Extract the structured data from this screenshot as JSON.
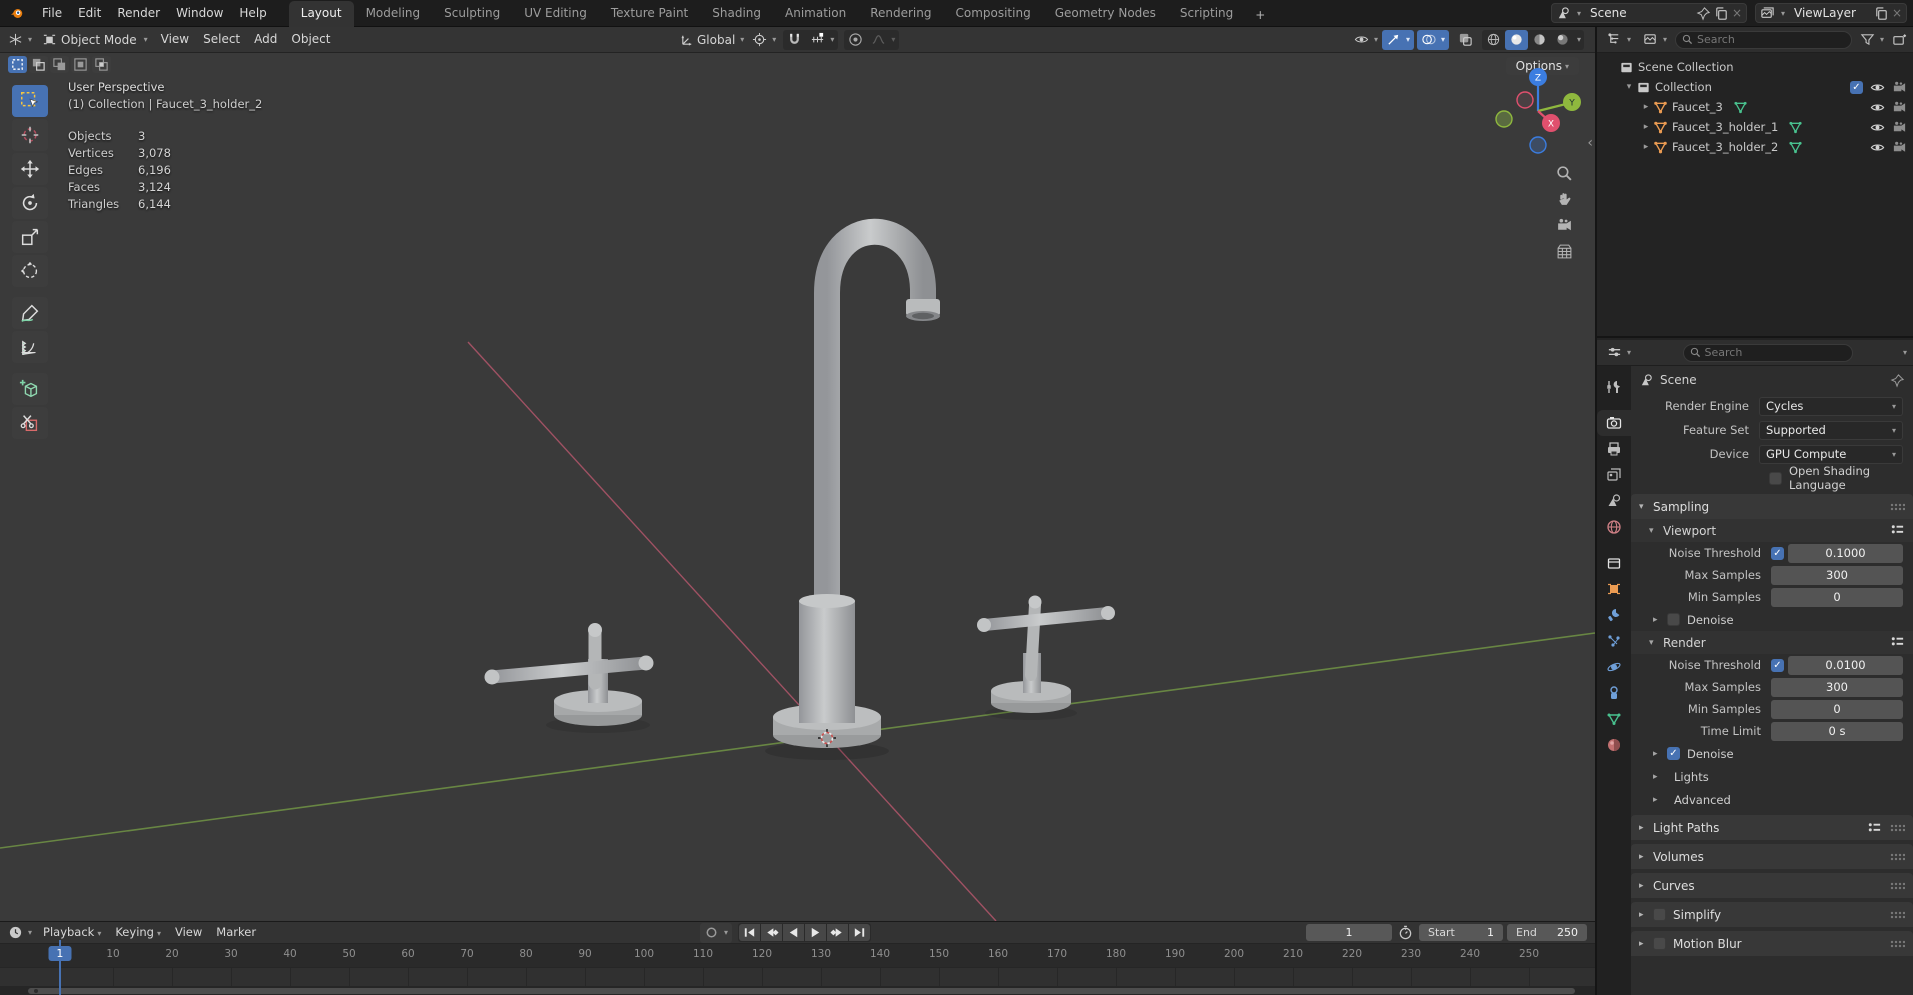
{
  "colors": {
    "accent": "#4772b3",
    "object_orange": "#eb9b52",
    "data_green": "#49c28f",
    "axis_x_red": "#b2566b",
    "axis_y_green": "#6e8f45",
    "gizmo_z": "#3b7de0",
    "gizmo_y": "#8fb83e",
    "gizmo_x": "#e0506e"
  },
  "topbar": {
    "menus": [
      "File",
      "Edit",
      "Render",
      "Window",
      "Help"
    ],
    "workspace_tabs": [
      "Layout",
      "Modeling",
      "Sculpting",
      "UV Editing",
      "Texture Paint",
      "Shading",
      "Animation",
      "Rendering",
      "Compositing",
      "Geometry Nodes",
      "Scripting"
    ],
    "active_tab": "Layout",
    "add_tab_label": "+",
    "scene_selector": {
      "value": "Scene"
    },
    "viewlayer_selector": {
      "value": "ViewLayer"
    }
  },
  "viewport_header": {
    "mode": "Object Mode",
    "menus": [
      "View",
      "Select",
      "Add",
      "Object"
    ],
    "orientation": "Global"
  },
  "viewport": {
    "options_label": "Options",
    "overlay": {
      "view_name": "User Perspective",
      "context": "(1) Collection | Faucet_3_holder_2",
      "stats": [
        {
          "label": "Objects",
          "value": "3"
        },
        {
          "label": "Vertices",
          "value": "3,078"
        },
        {
          "label": "Edges",
          "value": "6,196"
        },
        {
          "label": "Faces",
          "value": "3,124"
        },
        {
          "label": "Triangles",
          "value": "6,144"
        }
      ]
    },
    "gizmo_axes": {
      "z": "Z",
      "y": "Y",
      "x": "X"
    },
    "toolbar": [
      "select-box",
      "cursor",
      "move",
      "rotate",
      "scale",
      "transform",
      "annotate",
      "measure",
      "add-cube",
      "cut"
    ],
    "active_tool": "select-box"
  },
  "outliner": {
    "search_placeholder": "Search",
    "rows": [
      {
        "label": "Scene Collection",
        "icon": "scene-collection",
        "depth": 0,
        "expander": "",
        "checkbox": false,
        "eye": false,
        "camera": false,
        "data_icon": false
      },
      {
        "label": "Collection",
        "icon": "collection",
        "depth": 1,
        "expander": "open",
        "checkbox": true,
        "eye": true,
        "camera": true,
        "data_icon": false
      },
      {
        "label": "Faucet_3",
        "icon": "mesh",
        "depth": 2,
        "expander": "closed",
        "checkbox": false,
        "eye": true,
        "camera": true,
        "data_icon": true
      },
      {
        "label": "Faucet_3_holder_1",
        "icon": "mesh",
        "depth": 2,
        "expander": "closed",
        "checkbox": false,
        "eye": true,
        "camera": true,
        "data_icon": true
      },
      {
        "label": "Faucet_3_holder_2",
        "icon": "mesh",
        "depth": 2,
        "expander": "closed",
        "checkbox": false,
        "eye": true,
        "camera": true,
        "data_icon": true
      }
    ]
  },
  "properties": {
    "search_placeholder": "Search",
    "breadcrumb": "Scene",
    "tabs": [
      "tool",
      "render",
      "output",
      "view-layer",
      "scene",
      "world",
      "collection",
      "object",
      "modifiers",
      "particles",
      "physics",
      "constraints",
      "data",
      "material"
    ],
    "active_tab": "render",
    "rows": [
      {
        "type": "dropdown",
        "label": "Render Engine",
        "value": "Cycles"
      },
      {
        "type": "dropdown",
        "label": "Feature Set",
        "value": "Supported"
      },
      {
        "type": "dropdown",
        "label": "Device",
        "value": "GPU Compute"
      },
      {
        "type": "checkbox",
        "label": "Open Shading Language",
        "checked": false
      },
      {
        "type": "panel",
        "label": "Sampling",
        "expanded": true,
        "grip": true
      },
      {
        "type": "subpanel",
        "label": "Viewport",
        "expanded": true,
        "preset": true
      },
      {
        "type": "check_value",
        "label": "Noise Threshold",
        "checked": true,
        "value": "0.1000"
      },
      {
        "type": "value",
        "label": "Max Samples",
        "value": "300"
      },
      {
        "type": "value",
        "label": "Min Samples",
        "value": "0"
      },
      {
        "type": "subcollapse_check",
        "label": "Denoise",
        "checked": false
      },
      {
        "type": "subpanel",
        "label": "Render",
        "expanded": true,
        "preset": true
      },
      {
        "type": "check_value",
        "label": "Noise Threshold",
        "checked": true,
        "value": "0.0100"
      },
      {
        "type": "value",
        "label": "Max Samples",
        "value": "300"
      },
      {
        "type": "value",
        "label": "Min Samples",
        "value": "0"
      },
      {
        "type": "value",
        "label": "Time Limit",
        "value": "0 s"
      },
      {
        "type": "subcollapse_check",
        "label": "Denoise",
        "checked": true
      },
      {
        "type": "subcollapse",
        "label": "Lights"
      },
      {
        "type": "subcollapse",
        "label": "Advanced"
      },
      {
        "type": "panel",
        "label": "Light Paths",
        "expanded": false,
        "preset": true,
        "grip": true
      },
      {
        "type": "panel",
        "label": "Volumes",
        "expanded": false,
        "grip": true
      },
      {
        "type": "panel",
        "label": "Curves",
        "expanded": false,
        "grip": true
      },
      {
        "type": "panel_check",
        "label": "Simplify",
        "checked": false,
        "grip": true
      },
      {
        "type": "panel_check",
        "label": "Motion Blur",
        "checked": false,
        "grip": true
      }
    ]
  },
  "timeline": {
    "menus": [
      {
        "label": "Playback",
        "caret": true
      },
      {
        "label": "Keying",
        "caret": true
      },
      {
        "label": "View",
        "caret": false
      },
      {
        "label": "Marker",
        "caret": false
      }
    ],
    "transport": [
      "jump-start",
      "prev-keyframe",
      "play-reverse",
      "play",
      "next-keyframe",
      "jump-end"
    ],
    "current_frame": "1",
    "start_label": "Start",
    "start_value": "1",
    "end_label": "End",
    "end_value": "250",
    "playhead_frame": 1,
    "frame_labels": [
      10,
      20,
      30,
      40,
      50,
      60,
      70,
      80,
      90,
      100,
      110,
      120,
      130,
      140,
      150,
      160,
      170,
      180,
      190,
      200,
      210,
      220,
      230,
      240,
      250
    ]
  }
}
